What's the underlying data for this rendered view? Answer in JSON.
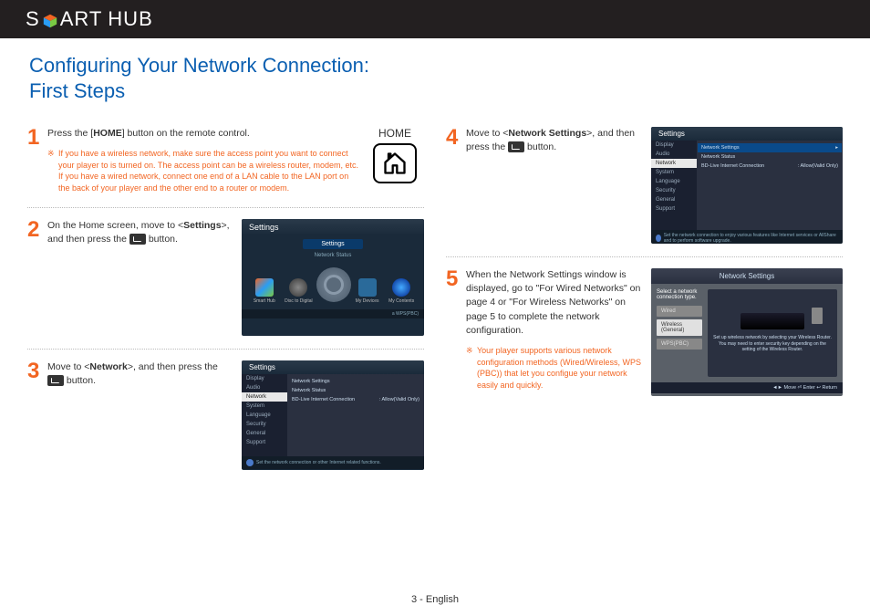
{
  "header": {
    "logo_prefix": "S",
    "logo_mid": "ART",
    "logo_suffix": "HUB"
  },
  "title_line1": "Configuring Your Network Connection:",
  "title_line2": "First Steps",
  "steps": {
    "s1": {
      "num": "1",
      "text_before": "Press the [",
      "text_bold": "HOME",
      "text_after": "] button on the remote control.",
      "note": "If you have a wireless network, make sure the access point you want to connect your player to is turned on. The access point can be a wireless router, modem, etc. If you have a wired network, connect one end of a LAN cable to the LAN port on the back of your player and the other end to a router or modem.",
      "home_label": "HOME"
    },
    "s2": {
      "num": "2",
      "text_a": "On the Home screen, move to <",
      "text_bold": "Settings",
      "text_b": ">, and then press the ",
      "text_c": " button.",
      "ss": {
        "title": "Settings",
        "menu_sel": "Settings",
        "sub": "Network Status",
        "icons": [
          "Smart Hub",
          "Disc to Digital",
          "",
          "My Devices",
          "My Contents"
        ],
        "foot": "a WPS(PBC)"
      }
    },
    "s3": {
      "num": "3",
      "text_a": "Move to <",
      "text_bold": "Network",
      "text_b": ">, and then press the ",
      "text_c": " button.",
      "ss": {
        "title": "Settings",
        "side": [
          "Display",
          "Audio",
          "Network",
          "System",
          "Language",
          "Security",
          "General",
          "Support"
        ],
        "rows": [
          {
            "l": "Network Settings",
            "r": ""
          },
          {
            "l": "Network Status",
            "r": ""
          },
          {
            "l": "BD-Live Internet Connection",
            "r": ": Allow(Valid Only)"
          }
        ],
        "foot": "Set the network connection or other Internet related functions."
      }
    },
    "s4": {
      "num": "4",
      "text_a": "Move to <",
      "text_bold": "Network Settings",
      "text_b": ">, and then press the ",
      "text_c": " button.",
      "ss": {
        "title": "Settings",
        "side": [
          "Display",
          "Audio",
          "Network",
          "System",
          "Language",
          "Security",
          "General",
          "Support"
        ],
        "rows": [
          {
            "l": "Network Settings",
            "r": ""
          },
          {
            "l": "Network Status",
            "r": ""
          },
          {
            "l": "BD-Live Internet Connection",
            "r": ": Allow(Valid Only)"
          }
        ],
        "foot": "Set the network connection to enjoy various features like Internet services or AllShare and to perform software upgrade."
      }
    },
    "s5": {
      "num": "5",
      "text": "When the Network Settings window is displayed, go to \"For Wired Networks\" on page 4 or \"For Wireless Networks\" on page 5 to complete the network configuration.",
      "note": "Your player supports various network configuration methods (Wired/Wireless, WPS (PBC)) that let you configue your network easily and quickly.",
      "ss": {
        "title": "Network Settings",
        "prompt": "Select a network connection type.",
        "opts": [
          "Wired",
          "Wireless (General)",
          "WPS(PBC)"
        ],
        "desc": "Set up wireless network by selecting your Wireless Router. You may need to enter security key depending on the setting of the Wireless Router.",
        "foot": "◄► Move   ⏎ Enter   ↩ Return"
      }
    }
  },
  "footer": "3 - English"
}
